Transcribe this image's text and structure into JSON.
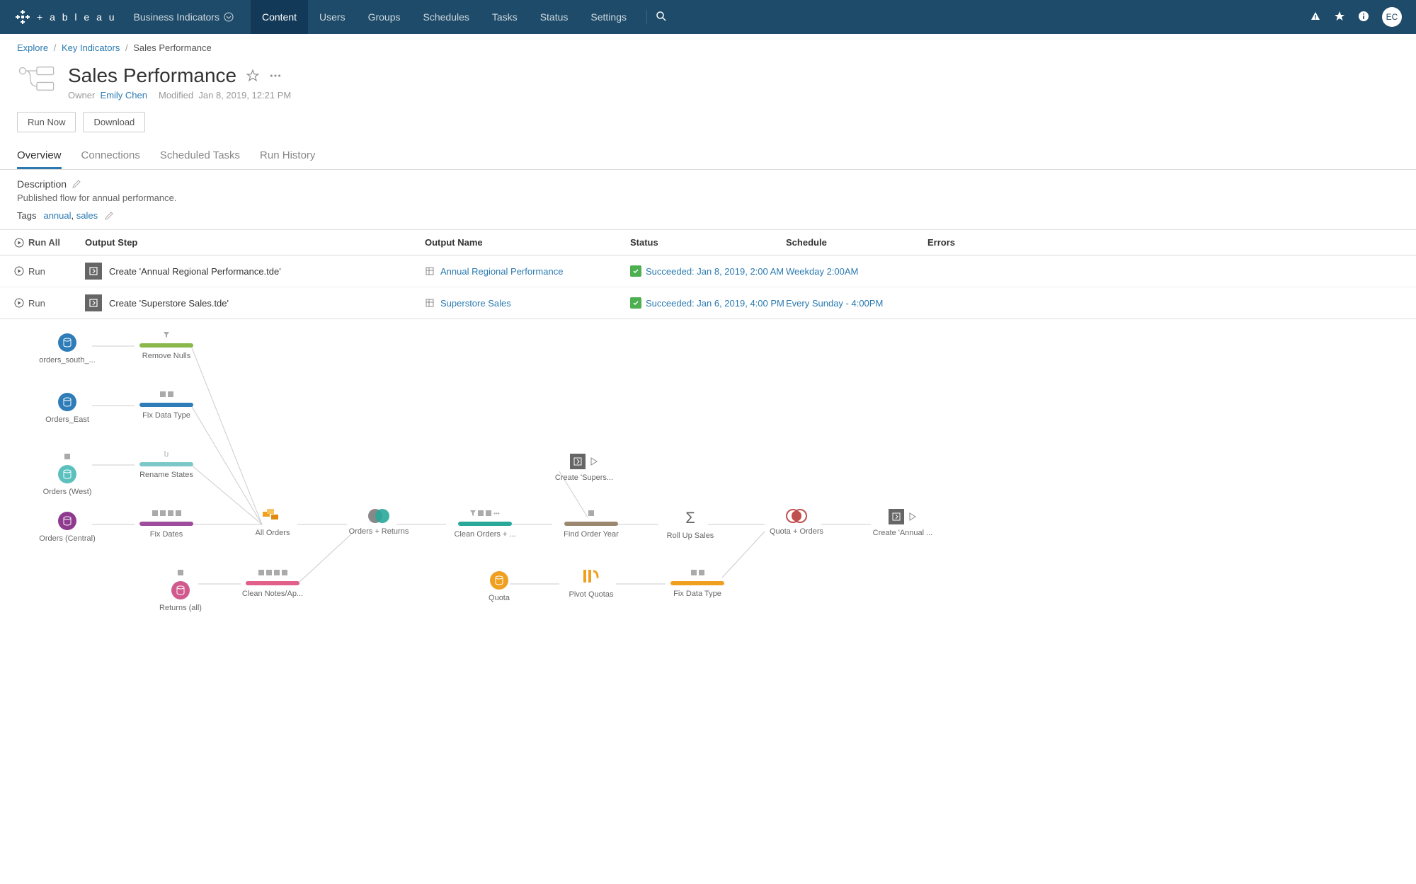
{
  "topnav": {
    "site": "Business Indicators",
    "items": [
      "Content",
      "Users",
      "Groups",
      "Schedules",
      "Tasks",
      "Status",
      "Settings"
    ],
    "active": 0,
    "avatar": "EC"
  },
  "breadcrumb": [
    {
      "label": "Explore",
      "link": true
    },
    {
      "label": "Key Indicators",
      "link": true
    },
    {
      "label": "Sales Performance",
      "link": false
    }
  ],
  "page": {
    "title": "Sales Performance",
    "owner_label": "Owner",
    "owner": "Emily Chen",
    "modified_label": "Modified",
    "modified": "Jan 8, 2019, 12:21 PM"
  },
  "buttons": {
    "run_now": "Run Now",
    "download": "Download"
  },
  "tabs": [
    "Overview",
    "Connections",
    "Scheduled Tasks",
    "Run History"
  ],
  "tabs_active": 0,
  "description": {
    "label": "Description",
    "text": "Published flow for annual performance."
  },
  "tags": {
    "label": "Tags",
    "items": [
      "annual",
      "sales"
    ]
  },
  "table": {
    "headers": {
      "run_all": "Run All",
      "output_step": "Output Step",
      "output_name": "Output Name",
      "status": "Status",
      "schedule": "Schedule",
      "errors": "Errors"
    },
    "rows": [
      {
        "run": "Run",
        "step": "Create 'Annual Regional Performance.tde'",
        "name": "Annual Regional Performance",
        "status": "Succeeded: Jan 8, 2019, 2:00 AM",
        "schedule": "Weekday 2:00AM"
      },
      {
        "run": "Run",
        "step": "Create 'Superstore Sales.tde'",
        "name": "Superstore Sales",
        "status": "Succeeded: Jan 6, 2019, 4:00 PM",
        "schedule": "Every Sunday - 4:00PM"
      }
    ]
  },
  "flow": {
    "nodes": {
      "orders_south": "orders_south_...",
      "orders_east": "Orders_East",
      "orders_west": "Orders (West)",
      "orders_central": "Orders (Central)",
      "returns_all": "Returns (all)",
      "remove_nulls": "Remove Nulls",
      "fix_data_type": "Fix Data Type",
      "rename_states": "Rename States",
      "fix_dates": "Fix Dates",
      "clean_notes": "Clean Notes/Ap...",
      "all_orders": "All Orders",
      "orders_returns": "Orders + Returns",
      "clean_orders": "Clean Orders + ...",
      "find_order_year": "Find Order Year",
      "create_supers": "Create 'Supers...",
      "roll_up_sales": "Roll Up Sales",
      "quota": "Quota",
      "pivot_quotas": "Pivot Quotas",
      "fix_data_type2": "Fix Data Type",
      "quota_orders": "Quota + Orders",
      "create_annual": "Create 'Annual ..."
    }
  }
}
